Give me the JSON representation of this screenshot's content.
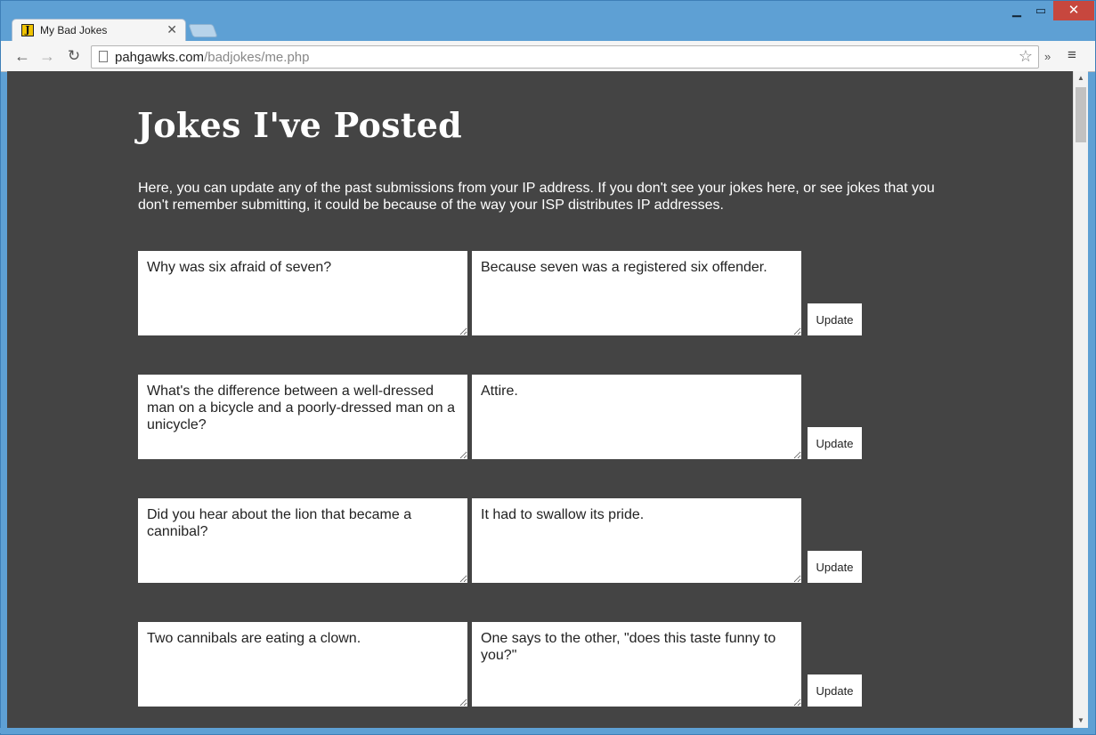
{
  "browser": {
    "tab_title": "My Bad Jokes",
    "tab_favicon": "J",
    "url_domain": "pahgawks.com",
    "url_path": "/badjokes/me.php"
  },
  "page": {
    "title": "Jokes I've Posted",
    "intro": "Here, you can update any of the past submissions from your IP address. If you don't see your jokes here, or see jokes that you don't remember submitting, it could be because of the way your ISP distributes IP addresses."
  },
  "jokes": [
    {
      "question": "Why was six afraid of seven?",
      "answer": "Because seven was a registered six offender.",
      "button": "Update"
    },
    {
      "question": "What's the difference between a well-dressed man on a bicycle and a poorly-dressed man on a unicycle?",
      "answer": "Attire.",
      "button": "Update"
    },
    {
      "question": "Did you hear about the lion that became a cannibal?",
      "answer": "It had to swallow its pride.",
      "button": "Update"
    },
    {
      "question": "Two cannibals are eating a clown.",
      "answer": "One says to the other, \"does this taste funny to you?\"",
      "button": "Update"
    }
  ]
}
